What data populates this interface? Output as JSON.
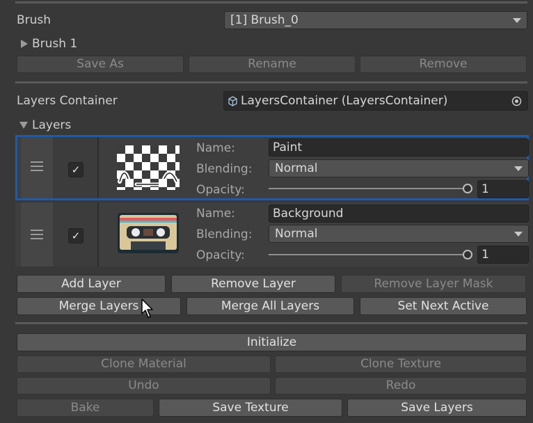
{
  "brush": {
    "label": "Brush",
    "selected": "[1] Brush_0",
    "foldout_label": "Brush 1",
    "save_as": "Save As",
    "rename": "Rename",
    "remove": "Remove"
  },
  "layers_container": {
    "label": "Layers Container",
    "value": "LayersContainer (LayersContainer)",
    "icon": "cube-icon",
    "picker_icon": "object-picker-icon"
  },
  "layers": {
    "foldout_label": "Layers",
    "selected_outline_color": "#1f5aa8",
    "items": [
      {
        "name_label": "Name:",
        "name": "Paint",
        "blending_label": "Blending:",
        "blending": "Normal",
        "opacity_label": "Opacity:",
        "opacity": "1",
        "opacity_fraction": 1.0,
        "enabled": true,
        "check": "✓",
        "selected": true,
        "thumbnail": "transparent-paint-strokes"
      },
      {
        "name_label": "Name:",
        "name": "Background",
        "blending_label": "Blending:",
        "blending": "Normal",
        "opacity_label": "Opacity:",
        "opacity": "1",
        "opacity_fraction": 1.0,
        "enabled": true,
        "check": "✓",
        "selected": false,
        "thumbnail": "cassette-tape-image"
      }
    ]
  },
  "layer_buttons": {
    "add_layer": "Add Layer",
    "remove_layer": "Remove Layer",
    "remove_layer_mask": "Remove Layer Mask",
    "merge_layers": "Merge Layers",
    "merge_all_layers": "Merge All Layers",
    "set_next_active": "Set Next Active"
  },
  "actions": {
    "initialize": "Initialize",
    "clone_material": "Clone Material",
    "clone_texture": "Clone Texture",
    "undo": "Undo",
    "redo": "Redo",
    "bake": "Bake",
    "save_texture": "Save Texture",
    "save_layers": "Save Layers"
  }
}
